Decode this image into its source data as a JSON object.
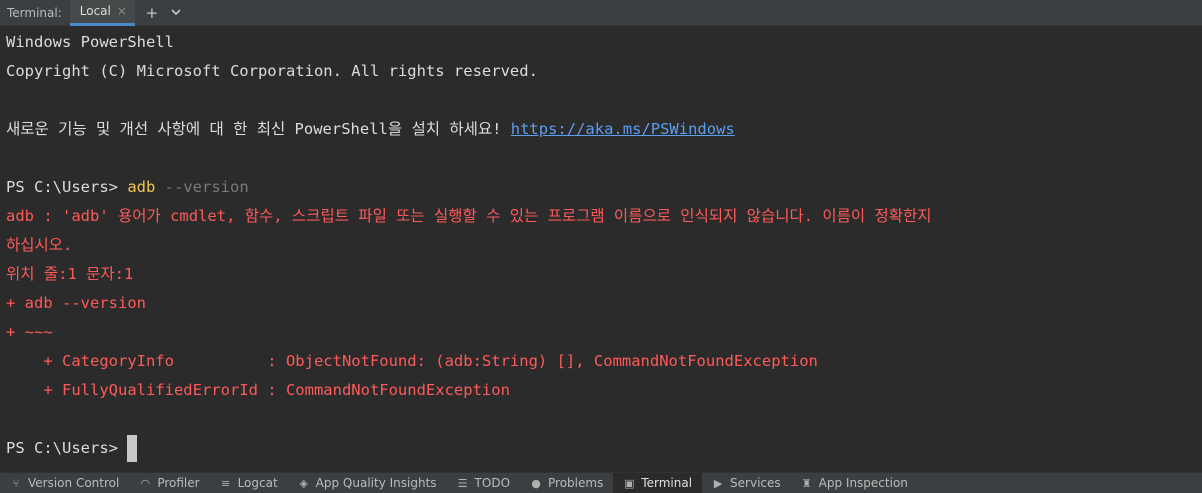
{
  "header": {
    "title": "Terminal:",
    "tab_label": "Local",
    "tab_close": "×",
    "new_tab": "+",
    "dropdown": "⌄"
  },
  "terminal": {
    "lines": [
      {
        "kind": "plain",
        "text": "Windows PowerShell"
      },
      {
        "kind": "plain",
        "text": "Copyright (C) Microsoft Corporation. All rights reserved."
      },
      {
        "kind": "blank",
        "text": ""
      },
      {
        "kind": "plain_link",
        "text": "새로운 기능 및 개선 사항에 대 한 최신 PowerShell을 설치 하세요! ",
        "link": "https://aka.ms/PSWindows"
      },
      {
        "kind": "blank",
        "text": ""
      },
      {
        "kind": "prompt_cmd",
        "prompt": "PS C:\\Users> ",
        "cmd": "adb",
        "args": " --version"
      },
      {
        "kind": "error",
        "text": "adb : 'adb' 용어가 cmdlet, 함수, 스크립트 파일 또는 실행할 수 있는 프로그램 이름으로 인식되지 않습니다. 이름이 정확한지"
      },
      {
        "kind": "error",
        "text": "하십시오."
      },
      {
        "kind": "error",
        "text": "위치 줄:1 문자:1"
      },
      {
        "kind": "error",
        "text": "+ adb --version"
      },
      {
        "kind": "error",
        "text": "+ ~~~"
      },
      {
        "kind": "error",
        "text": "    + CategoryInfo          : ObjectNotFound: (adb:String) [], CommandNotFoundException"
      },
      {
        "kind": "error",
        "text": "    + FullyQualifiedErrorId : CommandNotFoundException"
      },
      {
        "kind": "blank",
        "text": ""
      },
      {
        "kind": "prompt_cursor",
        "prompt": "PS C:\\Users> "
      }
    ]
  },
  "toolbar": {
    "items": [
      {
        "label": "Version Control",
        "icon": "branch-icon",
        "glyph": "⑂",
        "active": false
      },
      {
        "label": "Profiler",
        "icon": "gauge-icon",
        "glyph": "◠",
        "active": false
      },
      {
        "label": "Logcat",
        "icon": "logcat-icon",
        "glyph": "≡",
        "active": false
      },
      {
        "label": "App Quality Insights",
        "icon": "diamond-icon",
        "glyph": "◈",
        "active": false
      },
      {
        "label": "TODO",
        "icon": "list-icon",
        "glyph": "☰",
        "active": false
      },
      {
        "label": "Problems",
        "icon": "problems-icon",
        "glyph": "●",
        "active": false
      },
      {
        "label": "Terminal",
        "icon": "terminal-icon",
        "glyph": "▣",
        "active": true
      },
      {
        "label": "Services",
        "icon": "play-icon",
        "glyph": "▶",
        "active": false
      },
      {
        "label": "App Inspection",
        "icon": "inspection-icon",
        "glyph": "♜",
        "active": false
      }
    ]
  }
}
